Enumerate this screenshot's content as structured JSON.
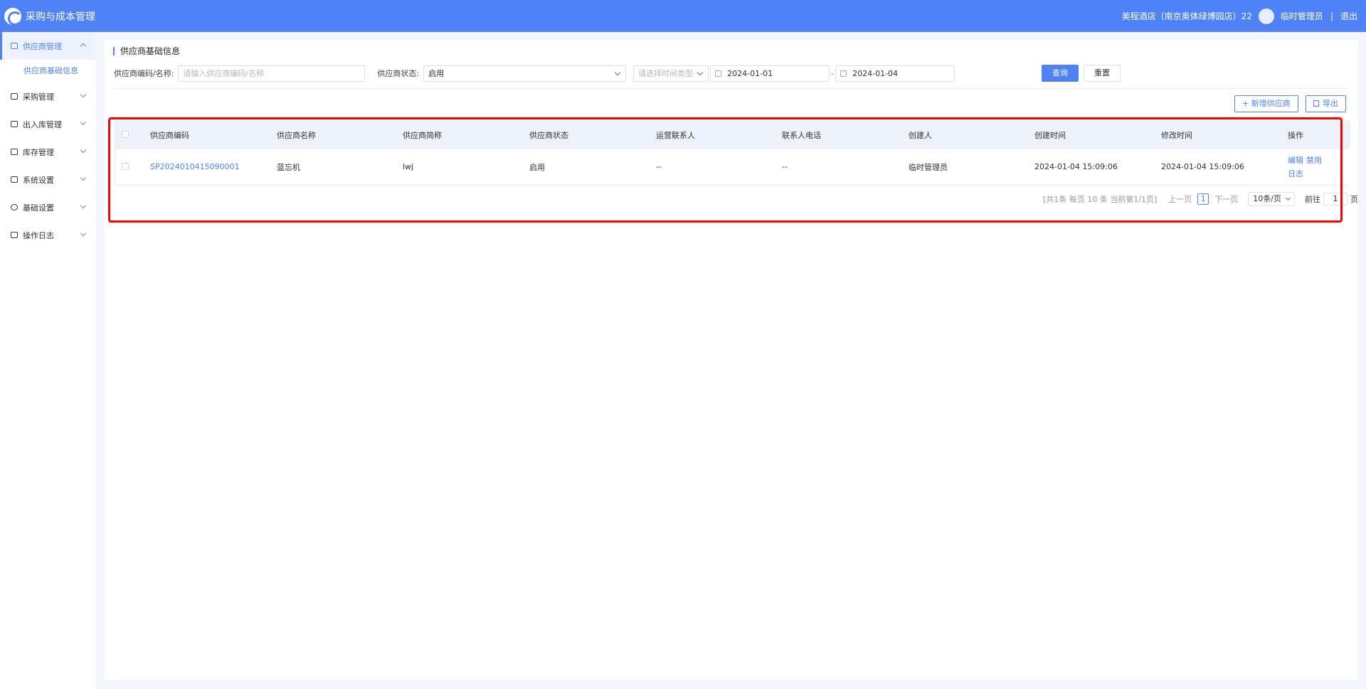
{
  "header": {
    "app_title": "采购与成本管理",
    "store": "美程酒店（南京奥体绿博园店）22",
    "user": "临时管理员",
    "divider": "|",
    "logout": "退出"
  },
  "sidebar": {
    "groups": [
      {
        "label": "供应商管理",
        "icon": "supplier-icon",
        "expanded": true
      },
      {
        "label": "采购管理",
        "icon": "purchase-icon"
      },
      {
        "label": "出入库管理",
        "icon": "inout-icon"
      },
      {
        "label": "库存管理",
        "icon": "inventory-icon"
      },
      {
        "label": "系统设置",
        "icon": "system-icon"
      },
      {
        "label": "基础设置",
        "icon": "settings-icon"
      },
      {
        "label": "操作日志",
        "icon": "log-icon"
      }
    ],
    "active_sub": "供应商基础信息"
  },
  "page": {
    "title": "供应商基础信息"
  },
  "filter": {
    "code_label": "供应商编码/名称:",
    "code_placeholder": "请输入供应商编码/名称",
    "status_label": "供应商状态:",
    "status_value": "启用",
    "time_type_placeholder": "请选择时间类型",
    "date_start": "2024-01-01",
    "date_sep": "-",
    "date_end": "2024-01-04",
    "query": "查询",
    "reset": "重置"
  },
  "actions": {
    "add": "+ 新增供应商",
    "export": "导出"
  },
  "table": {
    "columns": [
      "供应商编码",
      "供应商名称",
      "供应商简称",
      "供应商状态",
      "运营联系人",
      "联系人电话",
      "创建人",
      "创建时间",
      "修改时间",
      "操作"
    ],
    "rows": [
      {
        "code": "SP2024010415090001",
        "name": "蓝忘机",
        "short": "lwj",
        "status": "启用",
        "contact": "--",
        "phone": "--",
        "creator": "临时管理员",
        "created": "2024-01-04 15:09:06",
        "modified": "2024-01-04 15:09:06",
        "op_edit": "编辑",
        "op_disable": "禁用",
        "op_log": "日志"
      }
    ]
  },
  "pagination": {
    "summary": "[共1条 每页 10 条 当前第1/1页]",
    "prev": "上一页",
    "current": "1",
    "next": "下一页",
    "page_size": "10条/页",
    "goto_label": "前往",
    "goto_value": "1",
    "goto_unit": "页"
  },
  "colors": {
    "accent": "#4e82f6",
    "highlight": "#ff0000"
  }
}
